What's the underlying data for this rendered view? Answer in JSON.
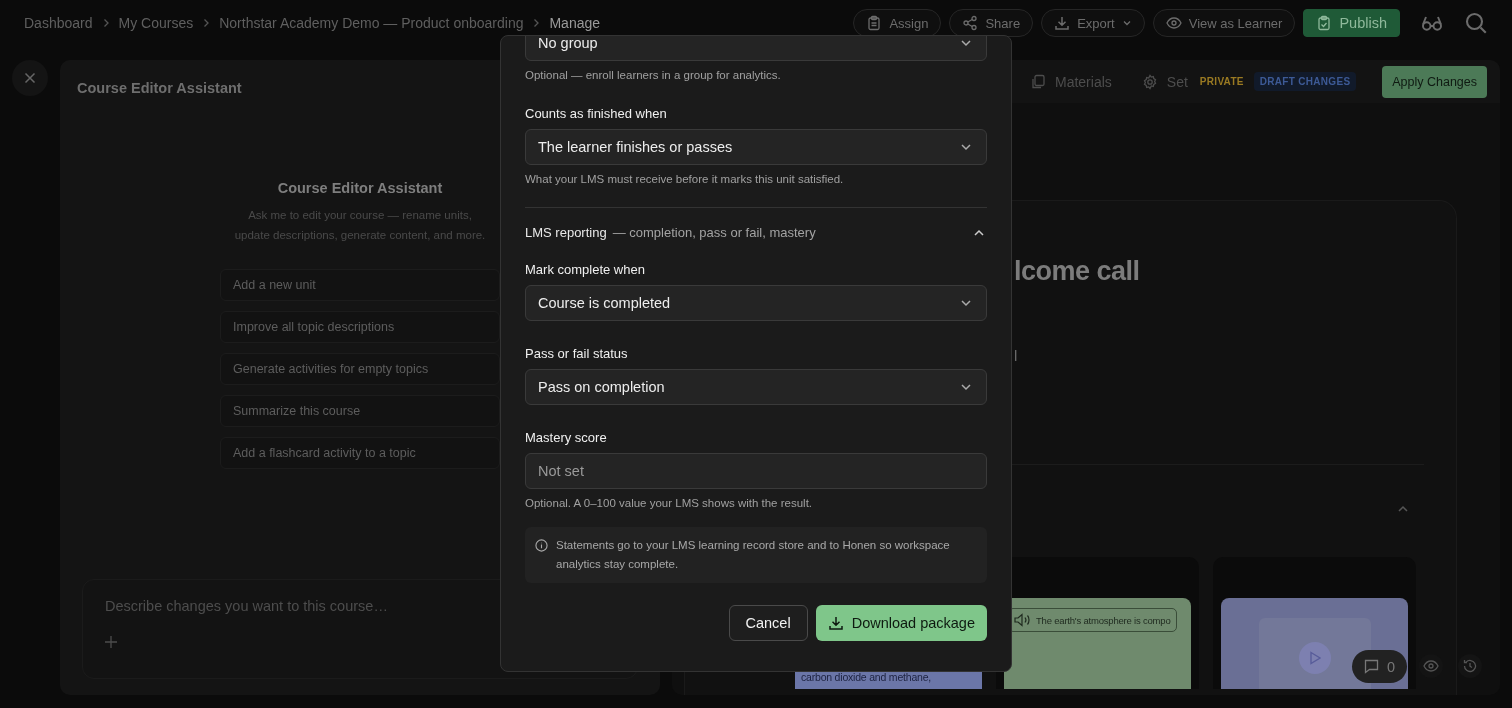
{
  "breadcrumbs": [
    {
      "label": "Dashboard",
      "current": false
    },
    {
      "label": "My Courses",
      "current": false
    },
    {
      "label": "Northstar Academy Demo — Product onboarding",
      "current": false
    },
    {
      "label": "Manage",
      "current": true
    }
  ],
  "toolbar": {
    "buttons": [
      {
        "label": "Assign",
        "kind": "outline"
      },
      {
        "label": "Share",
        "kind": "outline"
      },
      {
        "label": "Export",
        "kind": "dropdown"
      },
      {
        "label": "View as Learner",
        "kind": "outline"
      },
      {
        "label": "Publish",
        "kind": "primary"
      }
    ]
  },
  "assistant": {
    "title": "Course Editor Assistant",
    "heading": "Course Editor Assistant",
    "intro": "Ask me to edit your course — rename units, update descriptions, generate content, and more.",
    "suggestions": [
      "Add a new unit",
      "Improve all topic descriptions",
      "Generate activities for empty topics",
      "Summarize this course",
      "Add a flashcard activity to a topic"
    ],
    "prompt": {
      "placeholder": "Describe changes you want to this course…"
    }
  },
  "editor": {
    "tabs": [
      {
        "label": "Materials",
        "selected": false
      },
      {
        "label": "Set",
        "selected": false
      }
    ],
    "badges": [
      {
        "label": "PRIVATE",
        "color": "#9a7a22"
      },
      {
        "label": "DRAFT CHANGES",
        "color": "#3d5a96"
      }
    ],
    "apply_button": "Apply Changes",
    "unit_title": "lcome call",
    "unit_fragment": "l",
    "cards": [
      {
        "kind": "text",
        "lines": [
          "carbon dioxide and methane,"
        ]
      },
      {
        "kind": "audio",
        "text": "The earth's atmosphere is compo"
      },
      {
        "kind": "video"
      }
    ],
    "comments_count": "0"
  },
  "dialog": {
    "fields": [
      {
        "kind": "select",
        "value": "No group",
        "help": "Optional — enroll learners in a group for analytics."
      },
      {
        "kind": "select",
        "label": "Counts as finished when",
        "value": "The learner finishes or passes",
        "help": "What your LMS must receive before it marks this unit satisfied."
      },
      {
        "kind": "section",
        "label": "LMS reporting",
        "note": "— completion, pass or fail, mastery",
        "expanded": true
      },
      {
        "kind": "select",
        "label": "Mark complete when",
        "value": "Course is completed"
      },
      {
        "kind": "select",
        "label": "Pass or fail status",
        "value": "Pass on completion"
      },
      {
        "kind": "input",
        "label": "Mastery score",
        "placeholder": "Not set",
        "help": "Optional. A 0–100 value your LMS shows with the result."
      },
      {
        "kind": "info",
        "text": "Statements go to your LMS learning record store and to Honen so workspace analytics stay complete."
      }
    ],
    "cancel_button": "Cancel",
    "confirm_button": "Download package"
  }
}
